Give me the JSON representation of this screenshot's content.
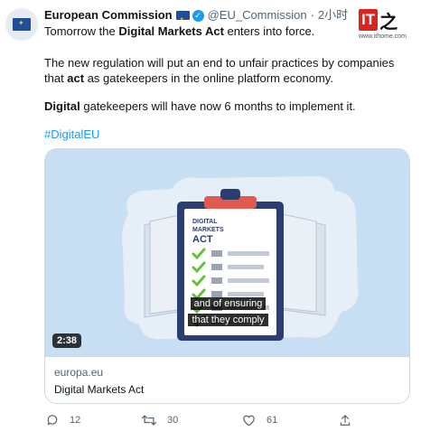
{
  "author": {
    "name": "European Commission",
    "handle": "@EU_Commission",
    "separator": "·",
    "time": "2小时"
  },
  "tweet": {
    "p1_a": "Tomorrow the ",
    "p1_b": "Digital Markets Act",
    "p1_c": " enters into force.",
    "p2_a": "The new regulation will put an end to unfair practices by companies that ",
    "p2_b": "act",
    "p2_c": " as gatekeepers in the online platform economy.",
    "p3_a": "Digital",
    "p3_b": " gatekeepers will have now 6 months to implement it.",
    "hashtag": "#DigitalEU"
  },
  "media": {
    "doc_line1": "DIGITAL",
    "doc_line2": "MARKETS",
    "doc_line3": "ACT",
    "caption_line1": "and of ensuring",
    "caption_line2": "that they comply",
    "duration": "2:38"
  },
  "card": {
    "domain": "europa.eu",
    "title": "Digital Markets Act"
  },
  "actions": {
    "replies": "12",
    "retweets": "30",
    "likes": "61"
  },
  "watermark": {
    "logo_it": "IT",
    "logo_zhi": "之",
    "url": "www.ithome.com"
  },
  "colors": {
    "accent": "#1d9bf0",
    "media_bg": "#c7def3",
    "check_green": "#6abf3a",
    "clipboard_navy": "#2c3e70",
    "watermark_red": "#d8251d"
  }
}
